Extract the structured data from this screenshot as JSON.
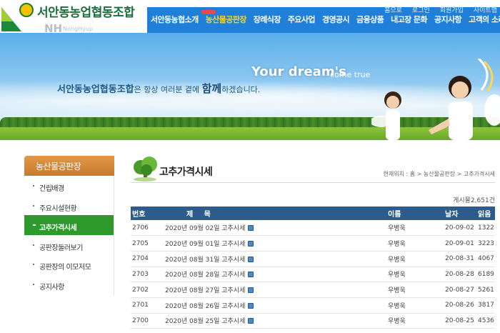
{
  "header": {
    "logo_title": "서안동농업협동조합",
    "logo_nh": "NH",
    "logo_nh_sub": "NongHyup",
    "utility": [
      "홈으로",
      "로그인",
      "회원가입",
      "사이트맵"
    ],
    "nav": [
      {
        "label": "서안동농협소개",
        "active": false
      },
      {
        "label": "농산물공판장",
        "active": true
      },
      {
        "label": "장례식장",
        "active": false
      },
      {
        "label": "주요사업",
        "active": false
      },
      {
        "label": "경영공시",
        "active": false
      },
      {
        "label": "금융상품",
        "active": false
      },
      {
        "label": "내고장 문화",
        "active": false
      },
      {
        "label": "공지사항",
        "active": false
      },
      {
        "label": "고객의 소리",
        "active": false
      }
    ]
  },
  "banner": {
    "slogan_main": "서안동농업협동조합",
    "slogan_part1": "은 항상 여러분 곁에 ",
    "slogan_em": "함께",
    "slogan_part2": "하겠습니다.",
    "dream": "Your dream's",
    "dream_sub": "come true"
  },
  "sidebar": {
    "title": "농산물공판장",
    "items": [
      {
        "label": "건립배경",
        "active": false
      },
      {
        "label": "주요시설현황",
        "active": false
      },
      {
        "label": "고추가격시세",
        "active": true
      },
      {
        "label": "공판장둘러보기",
        "active": false
      },
      {
        "label": "공판장의 이모저모",
        "active": false
      },
      {
        "label": "공지사항",
        "active": false
      }
    ]
  },
  "main": {
    "title": "고추가격시세",
    "breadcrumb": "현재위치 : 홈 > 농산물공판장 > 고추가격시세",
    "total": "게시물2,651건",
    "columns": [
      "번호",
      "제 목",
      "이름",
      "날자",
      "읽음"
    ],
    "rows": [
      {
        "no": "2706",
        "title": "2020년 09월 02일 고추시세",
        "name": "우병욱",
        "date": "20-09-02",
        "views": "1322"
      },
      {
        "no": "2705",
        "title": "2020년 09월 01일 고추시세",
        "name": "우병욱",
        "date": "20-09-01",
        "views": "3223"
      },
      {
        "no": "2704",
        "title": "2020년 08월 31일 고추시세",
        "name": "우병욱",
        "date": "20-08-31",
        "views": "4067"
      },
      {
        "no": "2703",
        "title": "2020년 08월 28일 고추시세",
        "name": "우병욱",
        "date": "20-08-28",
        "views": "6189"
      },
      {
        "no": "2702",
        "title": "2020년 08월 27일 고추시세",
        "name": "우병욱",
        "date": "20-08-27",
        "views": "5261"
      },
      {
        "no": "2701",
        "title": "2020년 08월 26일 고추시세",
        "name": "우병욱",
        "date": "20-08-26",
        "views": "3817"
      },
      {
        "no": "2700",
        "title": "2020년 08월 25일 고추시세",
        "name": "우병욱",
        "date": "20-08-25",
        "views": "4536"
      }
    ]
  },
  "colors": {
    "nav_blue": "#1f7fd9",
    "nav_active": "#ffd21a",
    "sidebar_active": "#2e9a2e",
    "sidebar_title": "#d4883a",
    "table_header": "#2d5c8c"
  }
}
